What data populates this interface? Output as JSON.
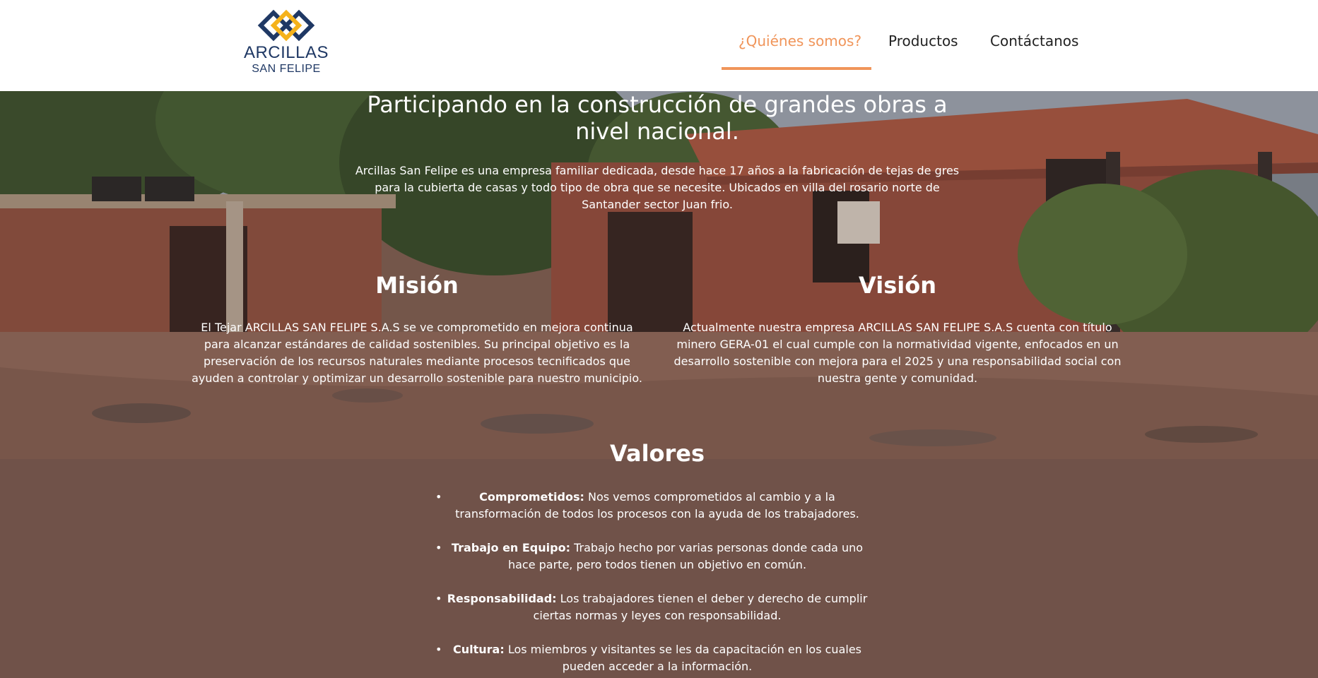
{
  "brand": {
    "name_line1": "ARCILLAS",
    "name_line2": "SAN FELIPE",
    "colors": {
      "navy": "#1f3864",
      "gold": "#f5b21b"
    }
  },
  "nav": {
    "items": [
      {
        "label": "¿Quiénes somos?",
        "active": true
      },
      {
        "label": "Productos",
        "active": false
      },
      {
        "label": "Contáctanos",
        "active": false
      }
    ],
    "accent_color": "#f0955a"
  },
  "hero": {
    "title": "Participando en la construcción de grandes obras a nivel nacional.",
    "text": "Arcillas San Felipe es una empresa familiar dedicada, desde hace 17 años a la fabricación de tejas de gres para la cubierta de casas y todo tipo de obra que se necesite. Ubicados en villa del rosario norte de Santander sector Juan frio."
  },
  "mision": {
    "title": "Misión",
    "text": "El Tejar ARCILLAS SAN FELIPE S.A.S se ve comprometido en mejora continua para alcanzar estándares de calidad sostenibles. Su principal objetivo es la preservación de los recursos naturales mediante procesos tecnificados que ayuden a controlar y optimizar un desarrollo sostenible para nuestro municipio."
  },
  "vision": {
    "title": "Visión",
    "text": "Actualmente nuestra empresa ARCILLAS SAN FELIPE S.A.S cuenta con título minero GERA-01 el cual cumple con la normatividad vigente, enfocados en un desarrollo sostenible con mejora para el 2025 y una responsabilidad social con nuestra gente y comunidad."
  },
  "valores": {
    "title": "Valores",
    "items": [
      {
        "term": "Comprometidos:",
        "text": "Nos vemos comprometidos al cambio y a la transformación de todos los procesos con la ayuda de los trabajadores."
      },
      {
        "term": "Trabajo en Equipo:",
        "text": "Trabajo hecho por varias personas donde cada uno hace parte, pero todos tienen un objetivo en común."
      },
      {
        "term": "Responsabilidad:",
        "text": "Los trabajadores tienen el deber y derecho de cumplir ciertas normas y leyes con responsabilidad."
      },
      {
        "term": "Cultura:",
        "text": "Los miembros y visitantes se les da capacitación en los cuales pueden acceder a la información."
      }
    ]
  }
}
